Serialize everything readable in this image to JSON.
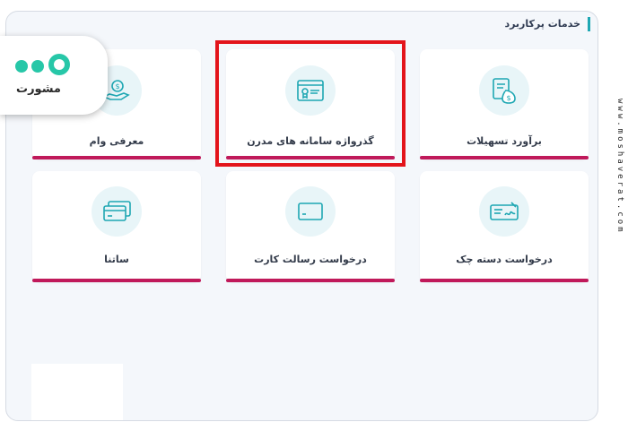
{
  "section_title": "خدمات پرکاربرد",
  "cards": [
    {
      "label": "برآورد تسهیلات",
      "icon": "money-document-icon"
    },
    {
      "label": "گذرواژه سامانه های مدرن",
      "icon": "browser-window-icon"
    },
    {
      "label": "معرفی وام",
      "icon": "hand-coin-icon"
    },
    {
      "label": "درخواست دسته چک",
      "icon": "cheque-icon"
    },
    {
      "label": "درخواست رسالت کارت",
      "icon": "card-icon"
    },
    {
      "label": "ساتنا",
      "icon": "cards-stack-icon"
    }
  ],
  "logo": {
    "text": "مشورت"
  },
  "watermark": "www.moshaverat.com",
  "colors": {
    "accent_bar": "#c0195a",
    "highlight": "#e3141b",
    "icon_stroke": "#1ea7b3",
    "circle_bg": "#e8f5f8"
  }
}
